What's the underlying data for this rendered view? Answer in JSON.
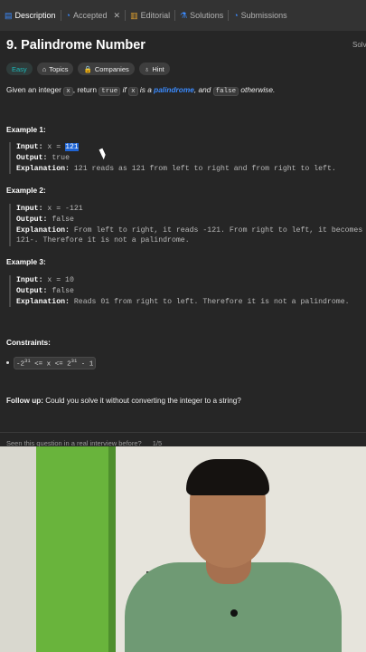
{
  "tabs": [
    {
      "label": "Description",
      "icon": "document-icon",
      "active": true
    },
    {
      "label": "Accepted",
      "icon": "history-icon",
      "active": false
    },
    {
      "label": "Editorial",
      "icon": "book-icon",
      "active": false
    },
    {
      "label": "Solutions",
      "icon": "flask-icon",
      "active": false
    },
    {
      "label": "Submissions",
      "icon": "history-icon",
      "active": false
    }
  ],
  "problem": {
    "title": "9. Palindrome Number",
    "solved_label": "Solv",
    "tags": {
      "difficulty": "Easy",
      "topics": "Topics",
      "companies": "Companies",
      "hint": "Hint"
    },
    "desc": {
      "p1": "Given an integer ",
      "c1": "x",
      "p2": ", return ",
      "c2": "true",
      "p3": " if ",
      "c3": "x",
      "p4": " is a ",
      "link": "palindrome",
      "p5": ", and ",
      "c4": "false",
      "p6": " otherwise."
    }
  },
  "examples": [
    {
      "heading": "Example 1:",
      "input_label": "Input:",
      "input_prefix": "x = ",
      "input_value": "121",
      "output_label": "Output:",
      "output_value": "true",
      "explanation_label": "Explanation:",
      "explanation": "121 reads as 121 from left to right and from right to left."
    },
    {
      "heading": "Example 2:",
      "input_label": "Input:",
      "input_value": "x = -121",
      "output_label": "Output:",
      "output_value": "false",
      "explanation_label": "Explanation:",
      "explanation": "From left to right, it reads -121. From right to left, it becomes",
      "explanation_cont": "121-. Therefore it is not a palindrome."
    },
    {
      "heading": "Example 3:",
      "input_label": "Input:",
      "input_value": "x = 10",
      "output_label": "Output:",
      "output_value": "false",
      "explanation_label": "Explanation:",
      "explanation": "Reads 01 from right to left. Therefore it is not a palindrome."
    }
  ],
  "constraints": {
    "heading": "Constraints:",
    "item_pre": "-2",
    "item_exp1": "31",
    "item_mid": " <= x <= 2",
    "item_exp2": "31",
    "item_post": " - 1"
  },
  "followup": {
    "label": "Follow up:",
    "text": " Could you solve it without converting the integer to a string?"
  },
  "footer": {
    "question": "Seen this question in a real interview before?",
    "pager": "1/5"
  },
  "colors": {
    "accent": "#1f64d3",
    "easy": "#1cb8b8",
    "link": "#3b8bff",
    "panel": "#262626"
  }
}
